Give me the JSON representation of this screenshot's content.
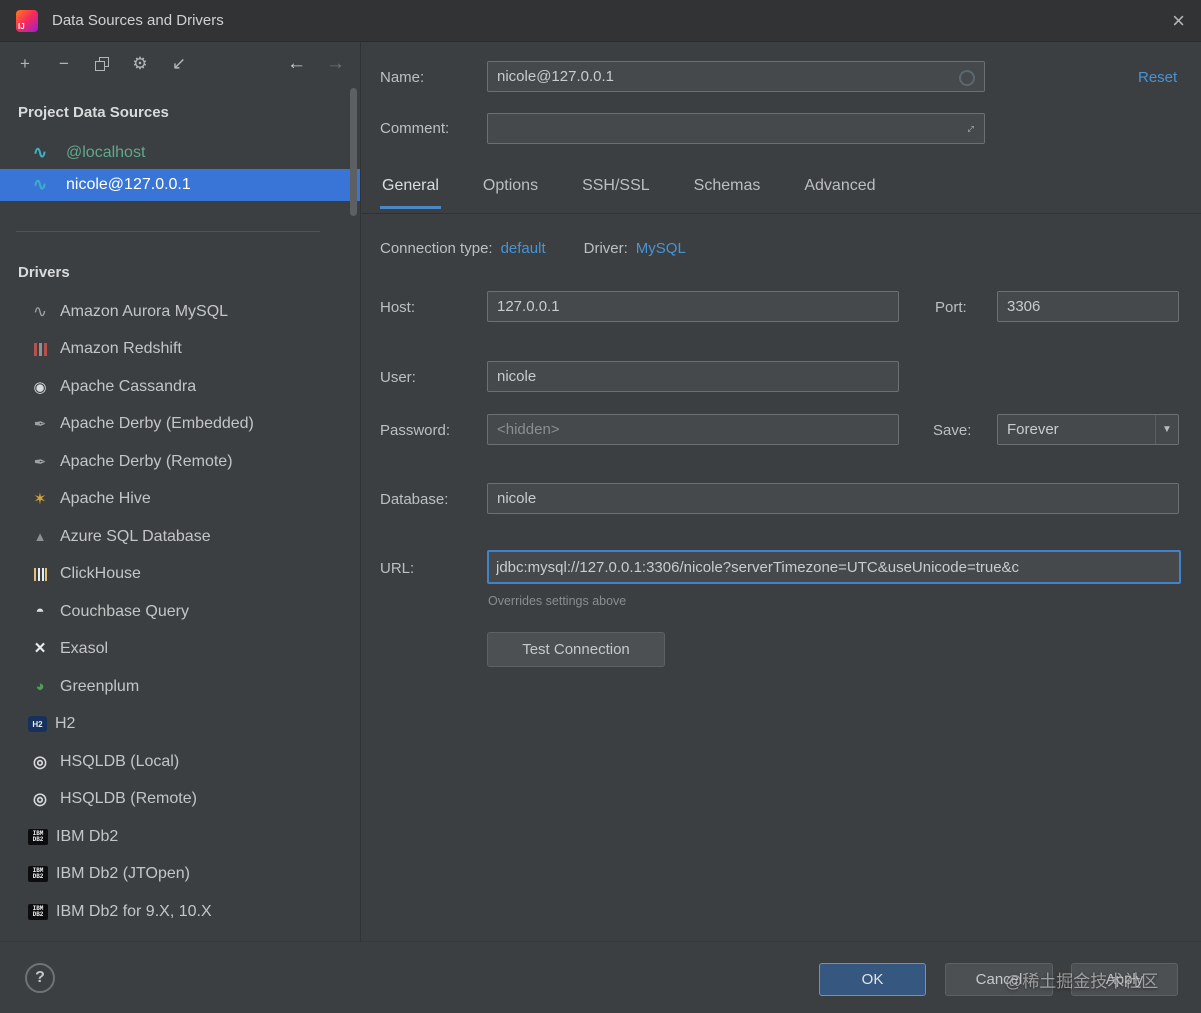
{
  "window": {
    "title": "Data Sources and Drivers"
  },
  "icons": {
    "add": "+",
    "remove": "−",
    "wrench": "⚙",
    "import": "↙",
    "back": "←",
    "forward": "→",
    "expand": "↔",
    "dropdown": "▼",
    "close": "×",
    "help": "?"
  },
  "sidebar": {
    "project_header": "Project Data Sources",
    "sources": [
      {
        "label": "@localhost",
        "icon": "mysql",
        "selected": false
      },
      {
        "label": "nicole@127.0.0.1",
        "icon": "mysql",
        "selected": true
      }
    ],
    "drivers_header": "Drivers",
    "drivers": [
      {
        "label": "Amazon Aurora MySQL",
        "icon": "aurora"
      },
      {
        "label": "Amazon Redshift",
        "icon": "redshift"
      },
      {
        "label": "Apache Cassandra",
        "icon": "cassandra"
      },
      {
        "label": "Apache Derby (Embedded)",
        "icon": "derby"
      },
      {
        "label": "Apache Derby (Remote)",
        "icon": "derby"
      },
      {
        "label": "Apache Hive",
        "icon": "hive"
      },
      {
        "label": "Azure SQL Database",
        "icon": "azure"
      },
      {
        "label": "ClickHouse",
        "icon": "clickhouse"
      },
      {
        "label": "Couchbase Query",
        "icon": "couchbase"
      },
      {
        "label": "Exasol",
        "icon": "exasol"
      },
      {
        "label": "Greenplum",
        "icon": "greenplum"
      },
      {
        "label": "H2",
        "icon": "h2"
      },
      {
        "label": "HSQLDB (Local)",
        "icon": "hsqldb"
      },
      {
        "label": "HSQLDB (Remote)",
        "icon": "hsqldb"
      },
      {
        "label": "IBM Db2",
        "icon": "db2"
      },
      {
        "label": "IBM Db2 (JTOpen)",
        "icon": "db2"
      },
      {
        "label": "IBM Db2 for 9.X, 10.X",
        "icon": "db2"
      }
    ]
  },
  "form": {
    "name_label": "Name:",
    "name_value": "nicole@127.0.0.1",
    "reset_label": "Reset",
    "comment_label": "Comment:",
    "comment_value": "",
    "tabs": [
      "General",
      "Options",
      "SSH/SSL",
      "Schemas",
      "Advanced"
    ],
    "active_tab": "General",
    "connection_type_label": "Connection type:",
    "connection_type_value": "default",
    "driver_label": "Driver:",
    "driver_value": "MySQL",
    "host_label": "Host:",
    "host_value": "127.0.0.1",
    "port_label": "Port:",
    "port_value": "3306",
    "user_label": "User:",
    "user_value": "nicole",
    "password_label": "Password:",
    "password_placeholder": "<hidden>",
    "save_label": "Save:",
    "save_value": "Forever",
    "database_label": "Database:",
    "database_value": "nicole",
    "url_label": "URL:",
    "url_value": "jdbc:mysql://127.0.0.1:3306/nicole?serverTimezone=UTC&useUnicode=true&c",
    "url_hint": "Overrides settings above",
    "test_button": "Test Connection"
  },
  "footer": {
    "ok": "OK",
    "cancel": "Cancel",
    "apply": "Apply",
    "watermark": "@稀土掘金技术社区"
  }
}
